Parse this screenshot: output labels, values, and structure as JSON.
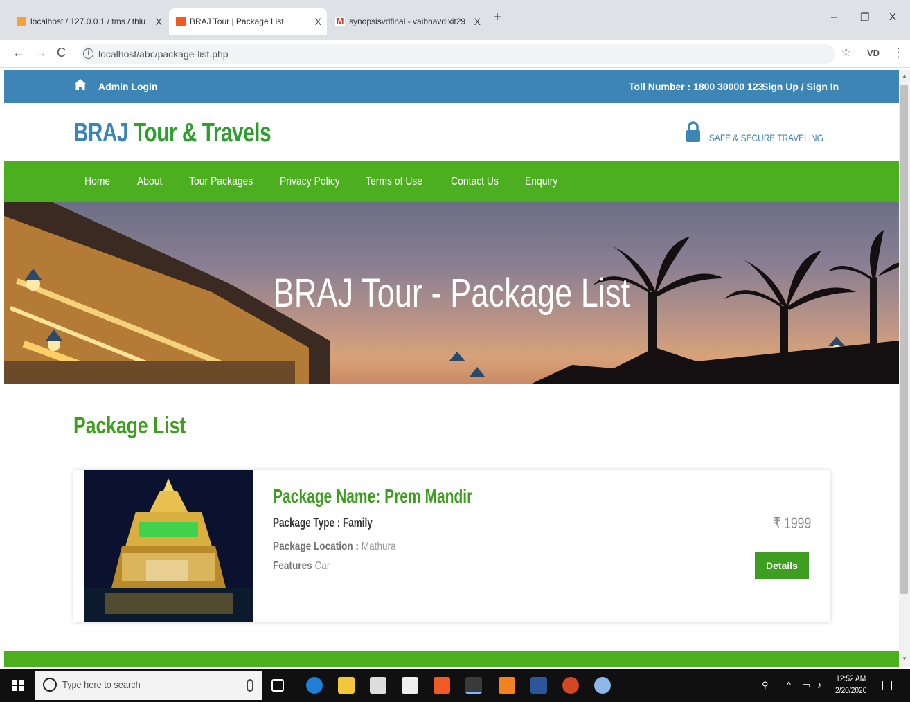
{
  "browser": {
    "tabs": [
      {
        "title": "localhost / 127.0.0.1 / tms / tblu",
        "close": "X"
      },
      {
        "title": "BRAJ Tour | Package List",
        "close": "X"
      },
      {
        "title": "synopsisvdfinal - vaibhavdixit29",
        "close": "X"
      }
    ],
    "new_tab": "+",
    "window_controls": {
      "minimize": "–",
      "restore": "❐",
      "close": "X"
    },
    "url": "localhost/abc/package-list.php"
  },
  "topbar": {
    "admin_login": "Admin Login",
    "toll": "Toll Number : 1800 30000 123",
    "signup": "Sign Up / Sign In"
  },
  "brand": {
    "logo_main": "BRAJ",
    "logo_rest": "Tour & Travels",
    "safe": "SAFE & SECURE TRAVELING"
  },
  "menu": [
    "Home",
    "About",
    "Tour Packages",
    "Privacy Policy",
    "Terms of Use",
    "Contact Us",
    "Enquiry"
  ],
  "hero": {
    "title": "BRAJ Tour - Package List"
  },
  "section": {
    "title": "Package List"
  },
  "package": {
    "name": "Package Name: Prem Mandir",
    "type": "Package Type : Family",
    "location_label": "Package Location :",
    "location": "Mathura",
    "features_label": "Features",
    "features": "Car",
    "price": "₹ 1999",
    "details": "Details"
  },
  "taskbar": {
    "search_placeholder": "Type here to search",
    "time": "12:52 AM",
    "date": "2/20/2020"
  },
  "colors": {
    "topbar": "#3d85b5",
    "menubar": "#4caf1f",
    "accent_green": "#3d9e1f"
  }
}
